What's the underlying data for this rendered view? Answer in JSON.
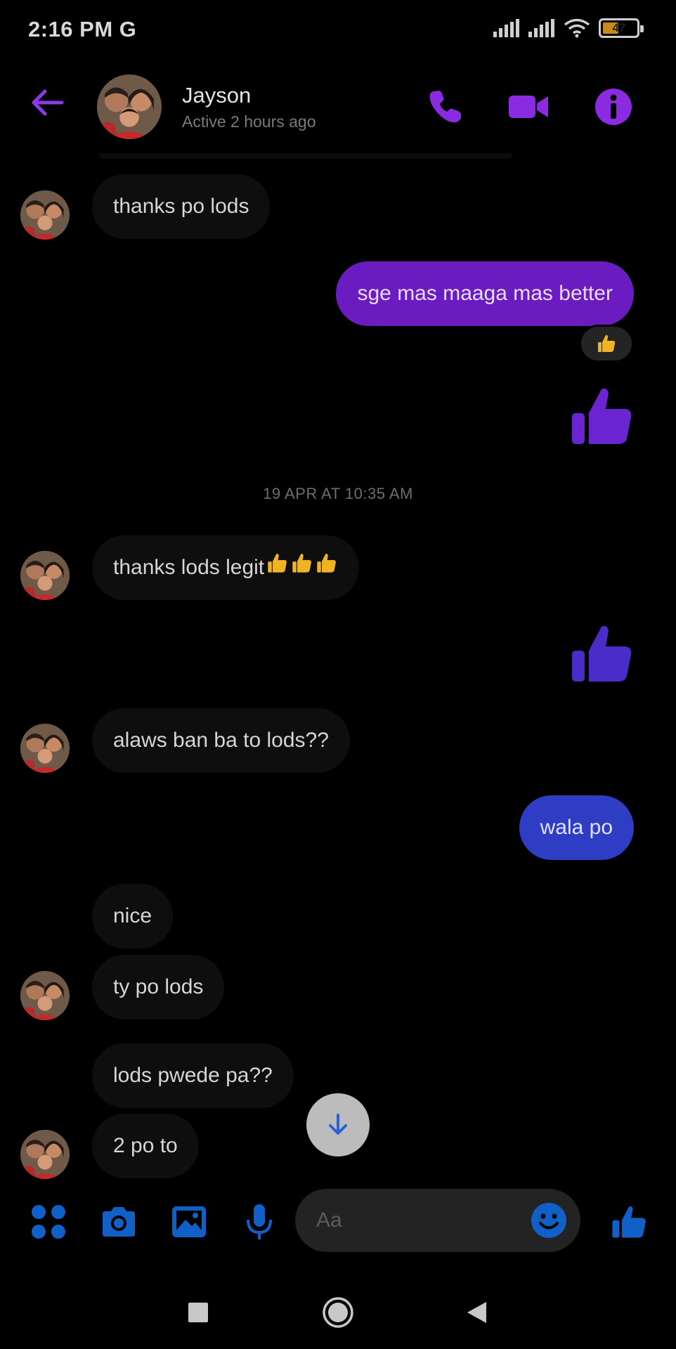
{
  "status_bar": {
    "time": "2:16 PM",
    "network": "G",
    "battery": "47"
  },
  "header": {
    "contact_name": "Jayson",
    "contact_status": "Active 2 hours ago"
  },
  "messages": [
    {
      "sender": "contact",
      "text": "thanks po lods"
    },
    {
      "sender": "me",
      "text": "sge mas maaga mas better",
      "reaction": "thumbs-up"
    },
    {
      "sender": "me",
      "type": "like"
    },
    {
      "type": "timestamp",
      "text": "19 APR AT 10:35 AM"
    },
    {
      "sender": "contact",
      "text": "thanks lods legit",
      "emoji_suffix": [
        "thumbs-up",
        "thumbs-up",
        "thumbs-up"
      ]
    },
    {
      "sender": "me",
      "type": "like"
    },
    {
      "sender": "contact",
      "text": "alaws ban ba to lods??"
    },
    {
      "sender": "me",
      "text": "wala po"
    },
    {
      "sender": "contact",
      "text": "nice"
    },
    {
      "sender": "contact",
      "text": "ty po lods"
    },
    {
      "sender": "contact",
      "text": "lods pwede pa??"
    },
    {
      "sender": "contact",
      "text": "2 po to"
    }
  ],
  "composer": {
    "placeholder": "Aa",
    "icons": [
      "apps-icon",
      "camera-icon",
      "gallery-icon",
      "microphone-icon",
      "emoji-icon",
      "like-icon"
    ]
  },
  "colors": {
    "accent_purple": "#7d2ae8",
    "accent_blue": "#1877f2",
    "outgoing_purple": "#6b1cc0",
    "outgoing_blue": "#2f3cc4"
  }
}
